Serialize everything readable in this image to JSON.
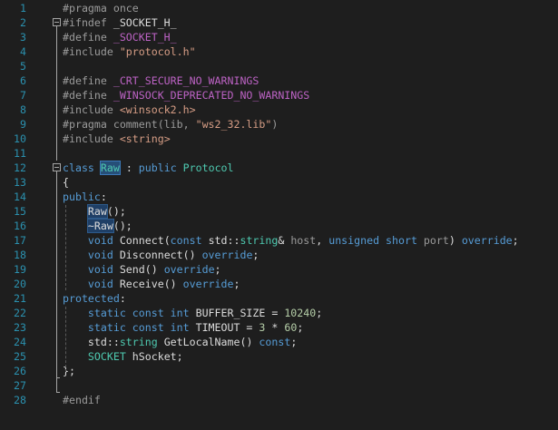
{
  "editor": {
    "lines": [
      {
        "n": "1",
        "tokens": [
          {
            "t": "#pragma once",
            "c": "pp"
          }
        ]
      },
      {
        "n": "2",
        "tokens": [
          {
            "t": "#ifndef ",
            "c": "pp"
          },
          {
            "t": "_SOCKET_H_",
            "c": "txt"
          }
        ]
      },
      {
        "n": "3",
        "tokens": [
          {
            "t": "#define ",
            "c": "pp"
          },
          {
            "t": "_SOCKET_H_",
            "c": "mac"
          }
        ]
      },
      {
        "n": "4",
        "tokens": [
          {
            "t": "#include ",
            "c": "pp"
          },
          {
            "t": "\"protocol.h\"",
            "c": "str"
          }
        ]
      },
      {
        "n": "5",
        "tokens": []
      },
      {
        "n": "6",
        "tokens": [
          {
            "t": "#define ",
            "c": "pp"
          },
          {
            "t": "_CRT_SECURE_NO_WARNINGS",
            "c": "mac"
          }
        ]
      },
      {
        "n": "7",
        "tokens": [
          {
            "t": "#define ",
            "c": "pp"
          },
          {
            "t": "_WINSOCK_DEPRECATED_NO_WARNINGS",
            "c": "mac"
          }
        ]
      },
      {
        "n": "8",
        "tokens": [
          {
            "t": "#include ",
            "c": "pp"
          },
          {
            "t": "<winsock2.h>",
            "c": "str"
          }
        ]
      },
      {
        "n": "9",
        "tokens": [
          {
            "t": "#pragma comment(lib, ",
            "c": "pp"
          },
          {
            "t": "\"ws2_32.lib\"",
            "c": "str"
          },
          {
            "t": ")",
            "c": "pp"
          }
        ]
      },
      {
        "n": "10",
        "tokens": [
          {
            "t": "#include ",
            "c": "pp"
          },
          {
            "t": "<string>",
            "c": "str"
          }
        ]
      },
      {
        "n": "11",
        "tokens": []
      },
      {
        "n": "12",
        "tokens": [
          {
            "t": "class ",
            "c": "kw"
          },
          {
            "t": "Raw",
            "c": "hl"
          },
          {
            "t": " : ",
            "c": "txt"
          },
          {
            "t": "public ",
            "c": "kw"
          },
          {
            "t": "Protocol",
            "c": "ty"
          }
        ]
      },
      {
        "n": "13",
        "tokens": [
          {
            "t": "{",
            "c": "txt"
          }
        ]
      },
      {
        "n": "14",
        "tokens": [
          {
            "t": "public",
            "c": "kw"
          },
          {
            "t": ":",
            "c": "txt"
          }
        ]
      },
      {
        "n": "15",
        "tokens": [
          {
            "t": "    ",
            "c": "txt"
          },
          {
            "t": "Raw",
            "c": "hl2"
          },
          {
            "t": "();",
            "c": "txt"
          }
        ]
      },
      {
        "n": "16",
        "tokens": [
          {
            "t": "    ",
            "c": "txt"
          },
          {
            "t": "~Raw",
            "c": "hl2"
          },
          {
            "t": "();",
            "c": "txt"
          }
        ]
      },
      {
        "n": "17",
        "tokens": [
          {
            "t": "    ",
            "c": "txt"
          },
          {
            "t": "void ",
            "c": "kw"
          },
          {
            "t": "Connect(",
            "c": "txt"
          },
          {
            "t": "const ",
            "c": "kw"
          },
          {
            "t": "std::",
            "c": "txt"
          },
          {
            "t": "string",
            "c": "ty"
          },
          {
            "t": "& ",
            "c": "txt"
          },
          {
            "t": "host",
            "c": "par"
          },
          {
            "t": ", ",
            "c": "txt"
          },
          {
            "t": "unsigned short ",
            "c": "kw"
          },
          {
            "t": "port",
            "c": "par"
          },
          {
            "t": ") ",
            "c": "txt"
          },
          {
            "t": "override",
            "c": "kw"
          },
          {
            "t": ";",
            "c": "txt"
          }
        ]
      },
      {
        "n": "18",
        "tokens": [
          {
            "t": "    ",
            "c": "txt"
          },
          {
            "t": "void ",
            "c": "kw"
          },
          {
            "t": "Disconnect() ",
            "c": "txt"
          },
          {
            "t": "override",
            "c": "kw"
          },
          {
            "t": ";",
            "c": "txt"
          }
        ]
      },
      {
        "n": "19",
        "tokens": [
          {
            "t": "    ",
            "c": "txt"
          },
          {
            "t": "void ",
            "c": "kw"
          },
          {
            "t": "Send() ",
            "c": "txt"
          },
          {
            "t": "override",
            "c": "kw"
          },
          {
            "t": ";",
            "c": "txt"
          }
        ]
      },
      {
        "n": "20",
        "tokens": [
          {
            "t": "    ",
            "c": "txt"
          },
          {
            "t": "void ",
            "c": "kw"
          },
          {
            "t": "Receive() ",
            "c": "txt"
          },
          {
            "t": "override",
            "c": "kw"
          },
          {
            "t": ";",
            "c": "txt"
          }
        ]
      },
      {
        "n": "21",
        "tokens": [
          {
            "t": "protected",
            "c": "kw"
          },
          {
            "t": ":",
            "c": "txt"
          }
        ]
      },
      {
        "n": "22",
        "tokens": [
          {
            "t": "    ",
            "c": "txt"
          },
          {
            "t": "static const int ",
            "c": "kw"
          },
          {
            "t": "BUFFER_SIZE = ",
            "c": "txt"
          },
          {
            "t": "10240",
            "c": "num"
          },
          {
            "t": ";",
            "c": "txt"
          }
        ]
      },
      {
        "n": "23",
        "tokens": [
          {
            "t": "    ",
            "c": "txt"
          },
          {
            "t": "static const int ",
            "c": "kw"
          },
          {
            "t": "TIMEOUT = ",
            "c": "txt"
          },
          {
            "t": "3",
            "c": "num"
          },
          {
            "t": " * ",
            "c": "txt"
          },
          {
            "t": "60",
            "c": "num"
          },
          {
            "t": ";",
            "c": "txt"
          }
        ]
      },
      {
        "n": "24",
        "tokens": [
          {
            "t": "    ",
            "c": "txt"
          },
          {
            "t": "std::",
            "c": "txt"
          },
          {
            "t": "string",
            "c": "ty"
          },
          {
            "t": " GetLocalName() ",
            "c": "txt"
          },
          {
            "t": "const",
            "c": "kw"
          },
          {
            "t": ";",
            "c": "txt"
          }
        ]
      },
      {
        "n": "25",
        "tokens": [
          {
            "t": "    ",
            "c": "txt"
          },
          {
            "t": "SOCKET",
            "c": "ty"
          },
          {
            "t": " hSocket;",
            "c": "txt"
          }
        ]
      },
      {
        "n": "26",
        "tokens": [
          {
            "t": "};",
            "c": "txt"
          }
        ]
      },
      {
        "n": "27",
        "tokens": []
      },
      {
        "n": "28",
        "tokens": [
          {
            "t": "#endif",
            "c": "pp"
          }
        ]
      }
    ]
  }
}
